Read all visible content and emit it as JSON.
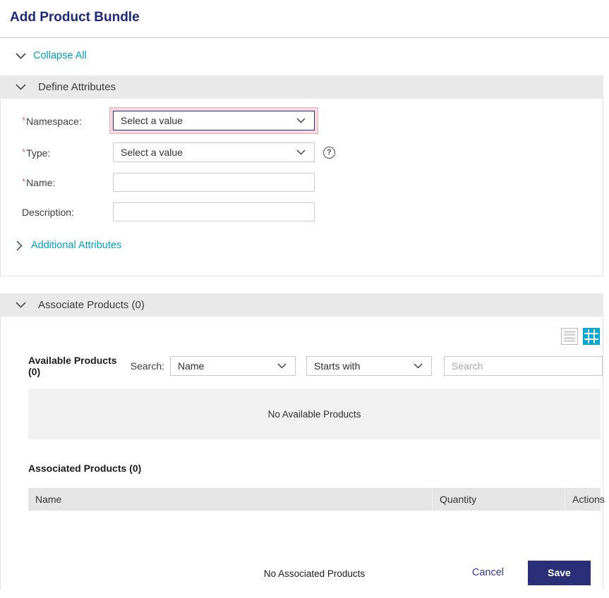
{
  "page": {
    "title": "Add Product Bundle"
  },
  "toolbar": {
    "collapse_all_label": "Collapse All"
  },
  "define_attributes": {
    "title": "Define Attributes",
    "namespace": {
      "required_mark": "*",
      "label": "Namespace:",
      "value": "Select a value"
    },
    "type": {
      "required_mark": "*",
      "label": "Type:",
      "value": "Select a value"
    },
    "name": {
      "required_mark": "*",
      "label": "Name:",
      "value": ""
    },
    "description": {
      "label": "Description:",
      "value": ""
    },
    "additional_attributes_label": "Additional Attributes"
  },
  "associate_products": {
    "title": "Associate Products (0)",
    "available": {
      "label": "Available Products (0)",
      "search_label": "Search:",
      "search_field_value": "Name",
      "search_operator_value": "Starts with",
      "search_placeholder": "Search",
      "empty_message": "No Available Products"
    },
    "associated": {
      "label": "Associated Products (0)",
      "columns": [
        "Name",
        "Quantity",
        "Actions"
      ],
      "empty_message": "No Associated Products"
    }
  },
  "footer": {
    "cancel_label": "Cancel",
    "save_label": "Save"
  },
  "icons": {
    "help": "?"
  },
  "colors": {
    "title_navy": "#1e2a78",
    "link_teal": "#00a3c7",
    "accent_navy": "#2b2f77",
    "focus_halo_pink": "#f6d9df",
    "grid_icon_cyan": "#00a9d4",
    "section_header_bg": "#e9e9e9",
    "required_pink": "#e4657a"
  }
}
